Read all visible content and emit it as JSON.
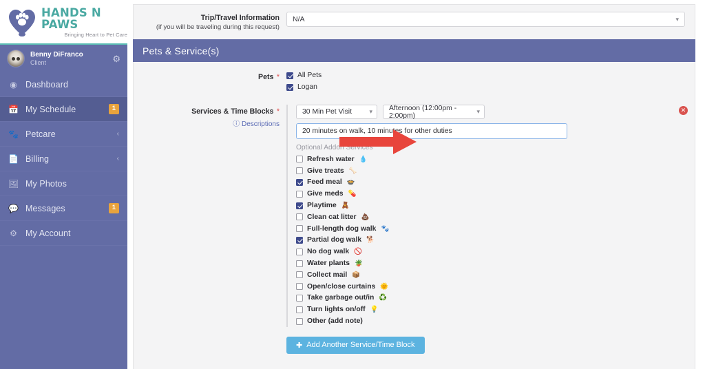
{
  "brand": {
    "title": "HANDS N PAWS",
    "tagline": "Bringing Heart to Pet Care",
    "logo_icon": "heart-paw-icon",
    "accent_teal": "#4aa9a2",
    "accent_purple": "#636ca5"
  },
  "user": {
    "name": "Benny DiFranco",
    "role": "Client",
    "avatar_icon": "cat-avatar",
    "settings_icon": "gear-icon"
  },
  "sidebar": {
    "items": [
      {
        "label": "Dashboard",
        "icon": "dashboard-icon",
        "badge": "",
        "chevron": "",
        "active": false
      },
      {
        "label": "My Schedule",
        "icon": "calendar-icon",
        "badge": "1",
        "chevron": "",
        "active": true
      },
      {
        "label": "Petcare",
        "icon": "paws-icon",
        "badge": "",
        "chevron": "‹",
        "active": false
      },
      {
        "label": "Billing",
        "icon": "document-icon",
        "badge": "",
        "chevron": "‹",
        "active": false
      },
      {
        "label": "My Photos",
        "icon": "photo-icon",
        "badge": "",
        "chevron": "",
        "active": false
      },
      {
        "label": "Messages",
        "icon": "chat-icon",
        "badge": "1",
        "chevron": "",
        "active": false
      },
      {
        "label": "My Account",
        "icon": "account-gear-icon",
        "badge": "",
        "chevron": "",
        "active": false
      }
    ]
  },
  "trip": {
    "label_line1": "Trip/Travel Information",
    "label_line2": "(if you will be traveling during this request)",
    "value": "N/A",
    "caret_icon": "chevron-down-icon"
  },
  "section": {
    "header": "Pets & Service(s)"
  },
  "pets": {
    "label": "Pets",
    "required_mark": "*",
    "options": [
      {
        "label": "All Pets",
        "checked": true
      },
      {
        "label": "Logan",
        "checked": true
      }
    ]
  },
  "services": {
    "label": "Services & Time Blocks",
    "required_mark": "*",
    "descriptions_link": "(❓ Descriptions)",
    "descriptions_text": "Descriptions",
    "help_icon": "question-circle-icon",
    "service_type": "30 Min Pet Visit",
    "time_block": "Afternoon (12:00pm - 2:00pm)",
    "note_value": "20 minutes on walk, 10 minutes for other duties",
    "addon_title": "Optional Addon Services",
    "remove_icon": "remove-circle-icon",
    "addons": [
      {
        "label": "Refresh water",
        "emoji": "💧",
        "checked": false
      },
      {
        "label": "Give treats",
        "emoji": "🦴",
        "checked": false
      },
      {
        "label": "Feed meal",
        "emoji": "🍲",
        "checked": true
      },
      {
        "label": "Give meds",
        "emoji": "💊",
        "checked": false
      },
      {
        "label": "Playtime",
        "emoji": "🧸",
        "checked": true
      },
      {
        "label": "Clean cat litter",
        "emoji": "💩",
        "checked": false
      },
      {
        "label": "Full-length dog walk",
        "emoji": "🐾",
        "checked": false
      },
      {
        "label": "Partial dog walk",
        "emoji": "🐕",
        "checked": true
      },
      {
        "label": "No dog walk",
        "emoji": "🚫",
        "checked": false
      },
      {
        "label": "Water plants",
        "emoji": "🪴",
        "checked": false
      },
      {
        "label": "Collect mail",
        "emoji": "📦",
        "checked": false
      },
      {
        "label": "Open/close curtains",
        "emoji": "🌞",
        "checked": false
      },
      {
        "label": "Take garbage out/in",
        "emoji": "♻️",
        "checked": false
      },
      {
        "label": "Turn lights on/off",
        "emoji": "💡",
        "checked": false
      },
      {
        "label": "Other (add note)",
        "emoji": "",
        "checked": false
      }
    ]
  },
  "add_button": {
    "label": "Add Another Service/Time Block",
    "icon": "plus-circle-icon"
  },
  "annotation": {
    "arrow_color": "#e8453c",
    "points_to": "service-note-input"
  }
}
